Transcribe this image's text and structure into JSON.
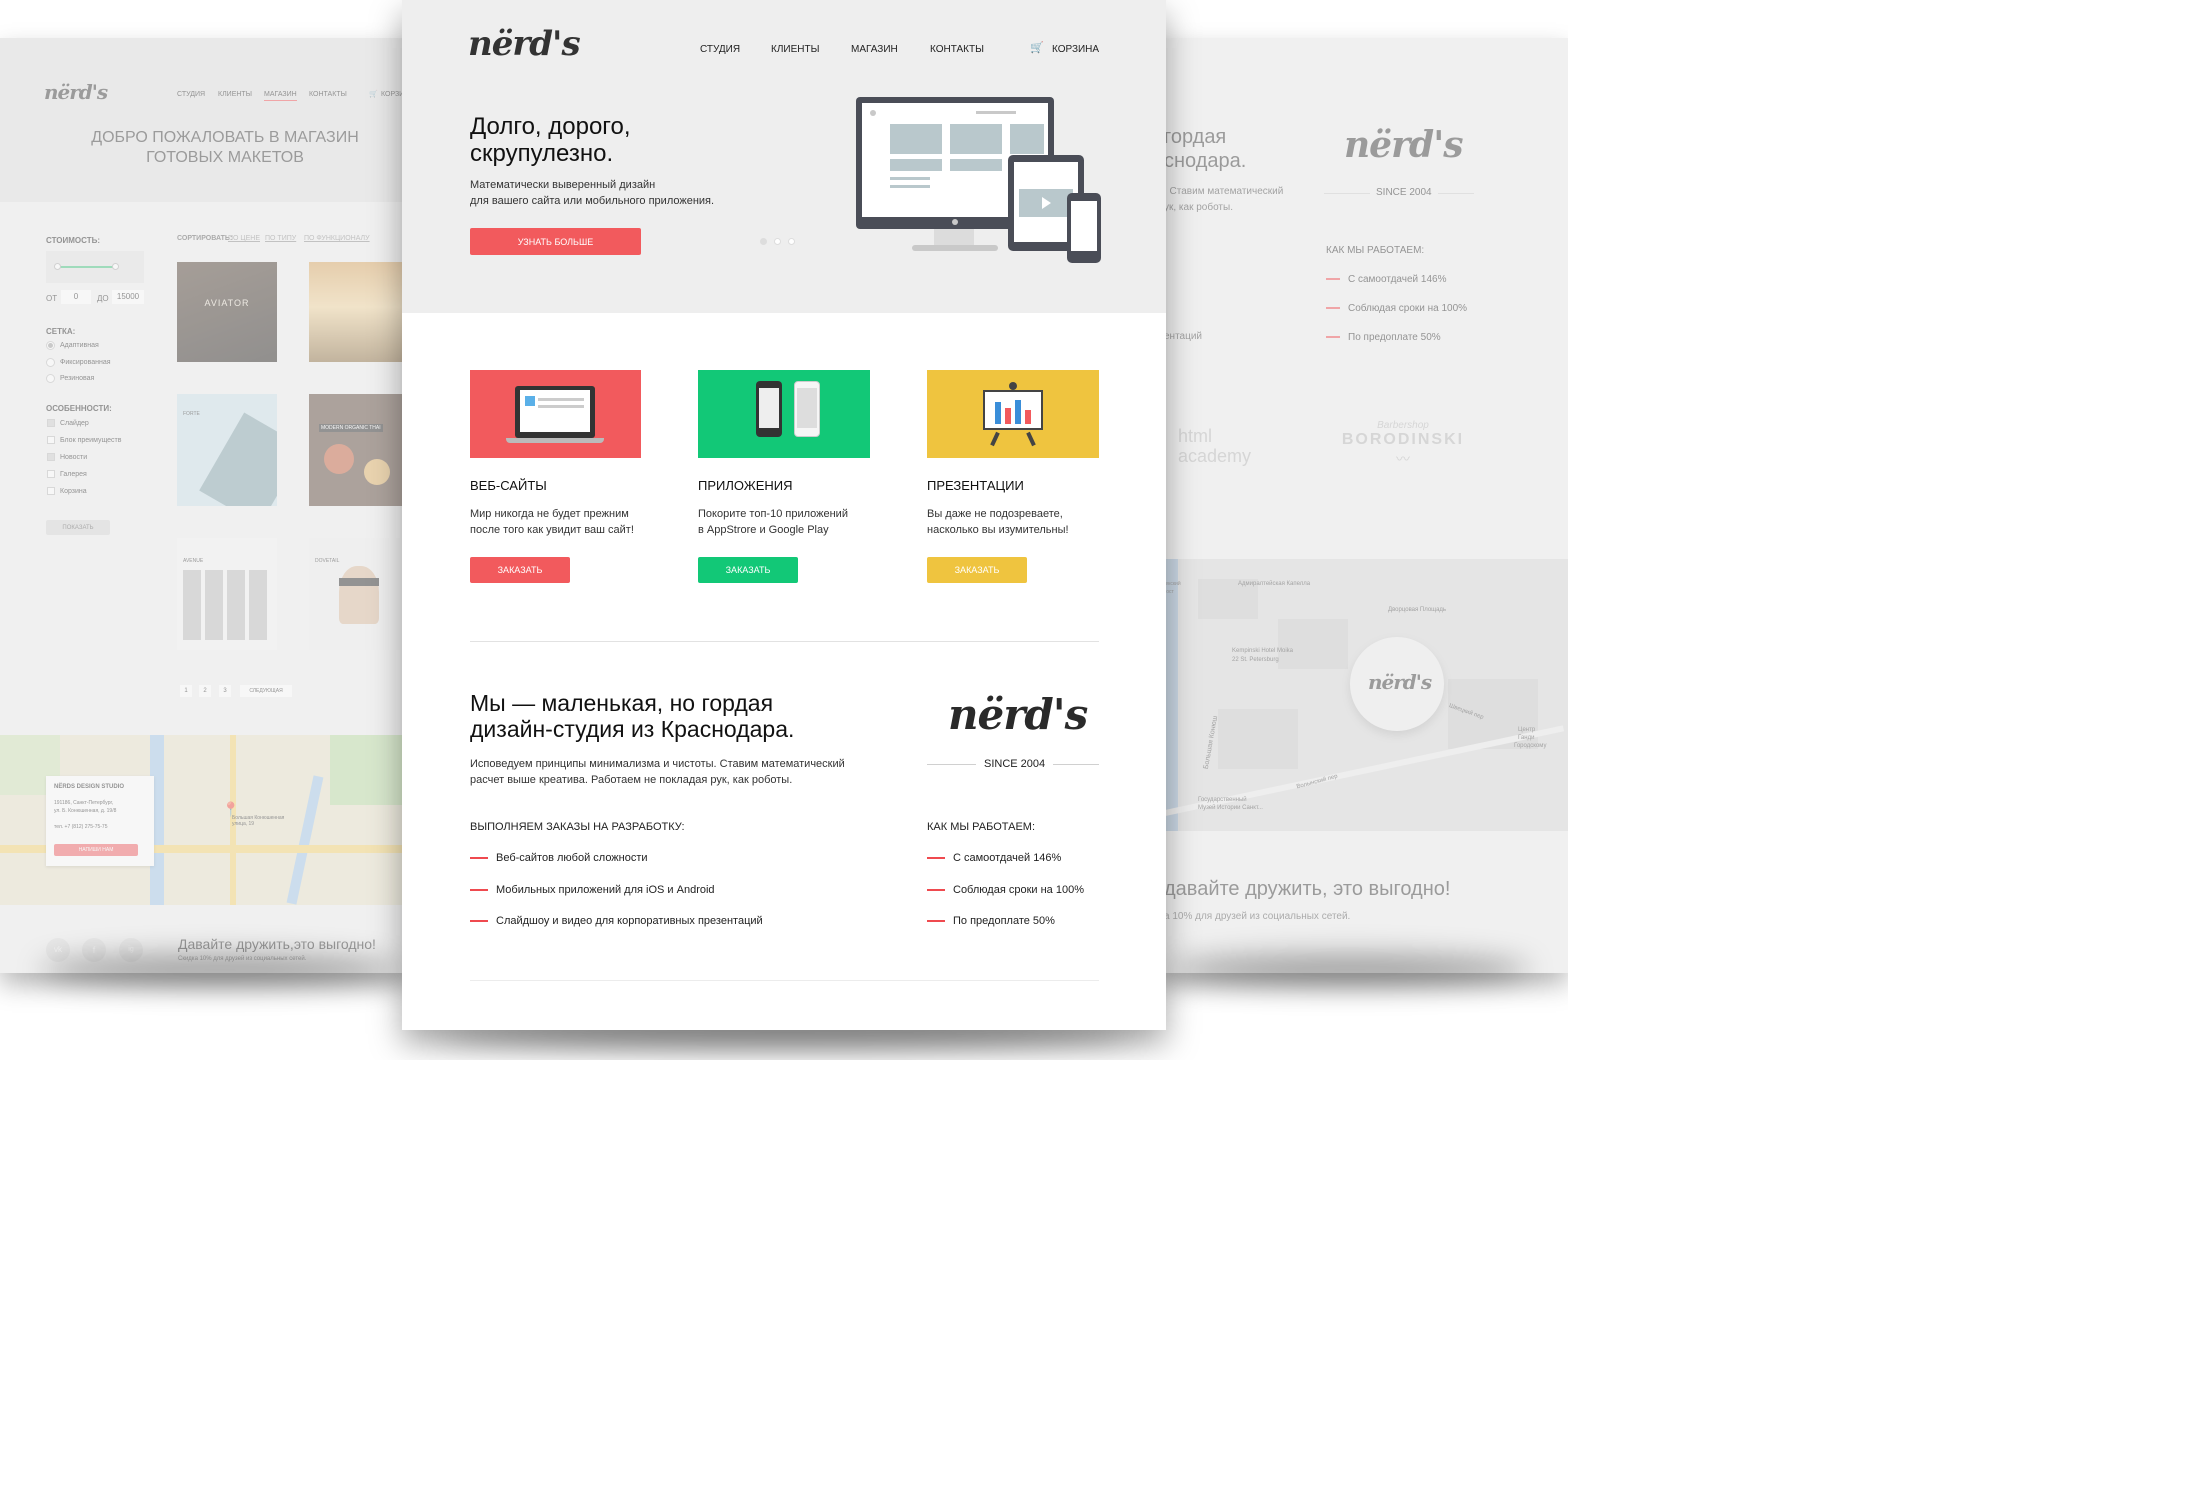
{
  "left": {
    "logo": "nërd's",
    "nav": [
      "СТУДИЯ",
      "КЛИЕНТЫ",
      "МАГАЗИН",
      "КОНТАКТЫ"
    ],
    "cart": "КОРЗИН",
    "hero_title_1": "ДОБРО ПОЖАЛОВАТЬ В МАГАЗИН",
    "hero_title_2": "ГОТОВЫХ МАКЕТОВ",
    "cost_label": "СТОИМОСТЬ:",
    "from_label": "ОТ",
    "from_value": "0",
    "to_label": "ДО",
    "to_value": "15000",
    "grid_label": "СЕТКА:",
    "grid_options": [
      "Адаптивная",
      "Фиксированная",
      "Резиновая"
    ],
    "features_label": "ОСОБЕННОСТИ:",
    "features": [
      "Слайдер",
      "Блок преимуществ",
      "Новости",
      "Галерея",
      "Корзина"
    ],
    "show_button": "ПОКАЗАТЬ",
    "sort_label": "СОРТИРОВАТЬ:",
    "sort_options": [
      "ПО ЦЕНЕ",
      "ПО ТИПУ",
      "ПО ФУНКЦИОНАЛУ"
    ],
    "thumb_titles": [
      "AVIATOR",
      "",
      "FORTE",
      "MODERN ORGANIC THAI",
      "AVENUE",
      "DOVETAIL"
    ],
    "pages": [
      "1",
      "2",
      "3"
    ],
    "next_page": "СЛЕДУЮЩАЯ",
    "studio_name": "NËRDS DESIGN STUDIO",
    "address_1": "191186, Санкт-Петербург,",
    "address_2": "ул. Б. Конюшенная, д. 19/8",
    "phone": "тел. +7 (812) 275-75-75",
    "write_button": "НАПИШИ НАМ",
    "map_pin_label": "Большая Конюшенная улица, 19",
    "friends_title": "Давайте дружить,это выгодно!",
    "friends_sub": "Скидка 10% для друзей из социальных сетей.",
    "social": [
      "vk",
      "f",
      "ig"
    ]
  },
  "center": {
    "logo": "nërd's",
    "nav": [
      "СТУДИЯ",
      "КЛИЕНТЫ",
      "МАГАЗИН",
      "КОНТАКТЫ"
    ],
    "cart": "КОРЗИНА",
    "hero_title_1": "Долго, дорого,",
    "hero_title_2": "скрупулезно.",
    "hero_text_1": "Математически выверенный дизайн",
    "hero_text_2": "для вашего сайта или мобильного приложения.",
    "hero_button": "УЗНАТЬ БОЛЬШЕ",
    "services": [
      {
        "title": "ВЕБ-САЙТЫ",
        "text_1": "Мир никогда не будет прежним",
        "text_2": "после того как увидит ваш сайт!",
        "button": "ЗАКАЗАТЬ",
        "color": "#f25a5d"
      },
      {
        "title": "ПРИЛОЖЕНИЯ",
        "text_1": "Покорите топ-10 приложений",
        "text_2": "в AppStrore и Google Play",
        "button": "ЗАКАЗАТЬ",
        "color": "#12c877"
      },
      {
        "title": "ПРЕЗЕНТАЦИИ",
        "text_1": "Вы даже не подозреваете,",
        "text_2": "насколько вы изумительны!",
        "button": "ЗАКАЗАТЬ",
        "color": "#efc43f"
      }
    ],
    "about_title_1": "Мы — маленькая, но гордая",
    "about_title_2": "дизайн-студия из Краснодара.",
    "about_text_1": "Исповедуем принципы минимализма и чистоты. Ставим математический",
    "about_text_2": "расчет выше креатива. Работаем не покладая рук, как роботы.",
    "since": "SINCE 2004",
    "orders_title": "ВЫПОЛНЯЕМ ЗАКАЗЫ НА РАЗРАБОТКУ:",
    "orders": [
      "Веб-сайтов любой сложности",
      "Мобильных приложений для iOS и Android",
      "Слайдшоу и видео для корпоративных презентаций"
    ],
    "how_title": "КАК МЫ РАБОТАЕМ:",
    "how": [
      "С самоотдачей 146%",
      "Соблюдая сроки на 100%",
      "По предоплате 50%"
    ]
  },
  "right": {
    "title_1": "гордая",
    "title_2": "снодара.",
    "text_1": ". Ставим математический",
    "text_2": "ук, как роботы.",
    "partial_item": "ентаций",
    "logo": "nërd's",
    "since": "SINCE 2004",
    "how_title": "КАК МЫ РАБОТАЕМ:",
    "how": [
      "С самоотдачей 146%",
      "Соблюдая сроки на 100%",
      "По предоплате 50%"
    ],
    "client_1a": "html",
    "client_1b": "academy",
    "client_2a": "Barbershop",
    "client_2b": "BORODINSKI",
    "map_labels": [
      "Дворцовая Площадь",
      "Kempinski Hotel Moika",
      "22 St. Petersburg",
      "Швецкий пер",
      "Волынский пер",
      "Государственный",
      "Музей Истории Санкт...",
      "Центр",
      "Ганди",
      "Городскому",
      "Адмиралтейская Капелла",
      "Большая Конюш",
      "Чекский",
      "Мост"
    ],
    "map_logo": "nërd's",
    "friends_title": "давайте дружить, это выгодно!",
    "friends_sub": "а 10% для друзей из социальных сетей."
  },
  "colors": {
    "red": "#f25a5d",
    "green": "#12c877",
    "yellow": "#efc43f",
    "dash": "#ef4a4f",
    "hero_bg": "#eeeeee"
  }
}
